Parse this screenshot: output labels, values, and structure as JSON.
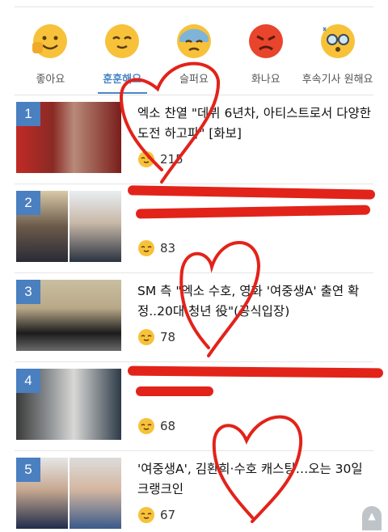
{
  "reactions": [
    {
      "label": "좋아요",
      "icon": "thumbs-up-face-icon",
      "active": false
    },
    {
      "label": "훈훈해요",
      "icon": "smiling-face-icon",
      "active": true
    },
    {
      "label": "슬퍼요",
      "icon": "sad-face-icon",
      "active": false
    },
    {
      "label": "화나요",
      "icon": "angry-face-icon",
      "active": false
    },
    {
      "label": "후속기사 원해요",
      "icon": "glasses-face-icon",
      "active": false
    }
  ],
  "articles": [
    {
      "rank": "1",
      "title": "엑소 찬열 \"데뷔 6년차, 아티스트로서 다양한 도전 하고파\" [화보]",
      "count": "215"
    },
    {
      "rank": "2",
      "title": "",
      "count": "83"
    },
    {
      "rank": "3",
      "title": "SM 측 \"엑소 수호, 영화 '여중생A' 출연 확정..20대 청년 役\"(공식입장)",
      "count": "78"
    },
    {
      "rank": "4",
      "title": "",
      "count": "68"
    },
    {
      "rank": "5",
      "title": "'여중생A', 김환희·수호 캐스팅…오는 30일 크랭크인",
      "count": "67"
    }
  ],
  "colors": {
    "accent": "#4a86c6",
    "rank_badge": "#4a7fc0",
    "scribble": "#e2231a"
  }
}
